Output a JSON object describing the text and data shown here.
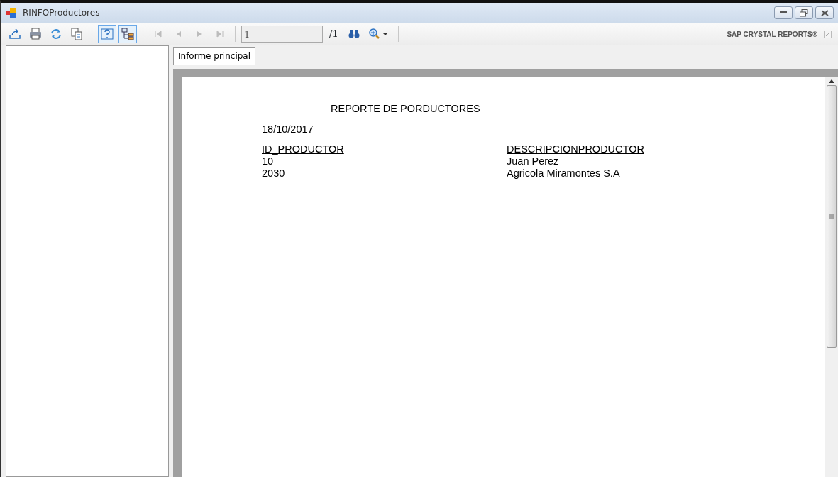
{
  "window": {
    "title": "RINFOProductores"
  },
  "toolbar": {
    "buttons": [
      {
        "kind": "export",
        "on": false,
        "disabled": false
      },
      {
        "kind": "print",
        "on": false,
        "disabled": false
      },
      {
        "kind": "refresh",
        "on": false,
        "disabled": false
      },
      {
        "kind": "copy",
        "on": false,
        "disabled": false
      },
      {
        "kind": "sep"
      },
      {
        "kind": "help",
        "on": true,
        "disabled": false
      },
      {
        "kind": "tree",
        "on": true,
        "disabled": false
      },
      {
        "kind": "sep"
      },
      {
        "kind": "first",
        "on": false,
        "disabled": true
      },
      {
        "kind": "prev",
        "on": false,
        "disabled": true
      },
      {
        "kind": "next",
        "on": false,
        "disabled": true
      },
      {
        "kind": "last",
        "on": false,
        "disabled": true
      },
      {
        "kind": "sep"
      }
    ],
    "page_field": {
      "value": "1"
    },
    "page_total": "/1",
    "brand": "SAP CRYSTAL REPORTS®"
  },
  "tabs": [
    {
      "label": "Informe principal",
      "selected": true
    }
  ],
  "report": {
    "title": "REPORTE DE PORDUCTORES",
    "date": "18/10/2017",
    "columns": [
      "ID_PRODUCTOR",
      "DESCRIPCIONPRODUCTOR"
    ],
    "rows": [
      [
        "10",
        "Juan Perez"
      ],
      [
        "2030",
        "Agricola Miramontes S.A"
      ]
    ]
  }
}
